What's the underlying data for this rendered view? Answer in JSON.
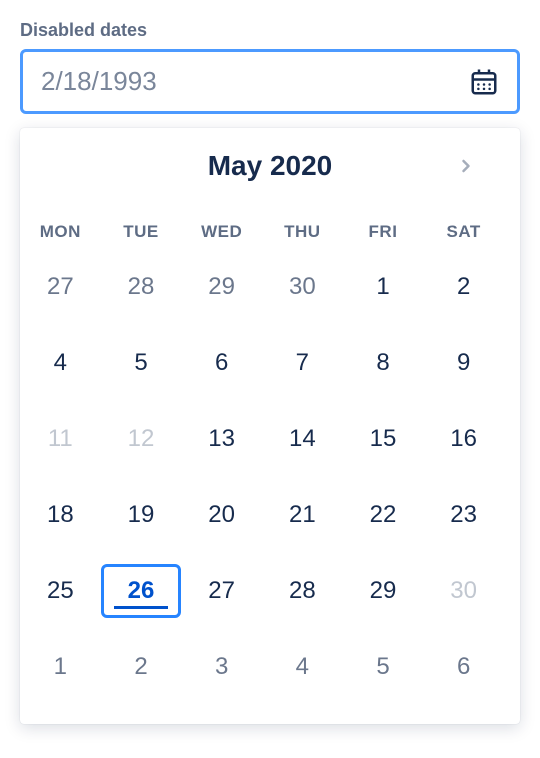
{
  "field": {
    "label": "Disabled dates",
    "placeholder": "2/18/1993"
  },
  "calendar": {
    "monthYear": "May 2020",
    "weekdays": [
      "MON",
      "TUE",
      "WED",
      "THU",
      "FRI",
      "SAT"
    ],
    "days": [
      {
        "num": "27",
        "type": "other-month"
      },
      {
        "num": "28",
        "type": "other-month"
      },
      {
        "num": "29",
        "type": "other-month"
      },
      {
        "num": "30",
        "type": "other-month"
      },
      {
        "num": "1",
        "type": "normal"
      },
      {
        "num": "2",
        "type": "normal"
      },
      {
        "num": "4",
        "type": "normal"
      },
      {
        "num": "5",
        "type": "normal"
      },
      {
        "num": "6",
        "type": "normal"
      },
      {
        "num": "7",
        "type": "normal"
      },
      {
        "num": "8",
        "type": "normal"
      },
      {
        "num": "9",
        "type": "normal"
      },
      {
        "num": "11",
        "type": "disabled"
      },
      {
        "num": "12",
        "type": "disabled"
      },
      {
        "num": "13",
        "type": "normal"
      },
      {
        "num": "14",
        "type": "normal"
      },
      {
        "num": "15",
        "type": "normal"
      },
      {
        "num": "16",
        "type": "normal"
      },
      {
        "num": "18",
        "type": "normal"
      },
      {
        "num": "19",
        "type": "normal"
      },
      {
        "num": "20",
        "type": "normal"
      },
      {
        "num": "21",
        "type": "normal"
      },
      {
        "num": "22",
        "type": "normal"
      },
      {
        "num": "23",
        "type": "normal"
      },
      {
        "num": "25",
        "type": "normal"
      },
      {
        "num": "26",
        "type": "selected"
      },
      {
        "num": "27",
        "type": "normal"
      },
      {
        "num": "28",
        "type": "normal"
      },
      {
        "num": "29",
        "type": "normal"
      },
      {
        "num": "30",
        "type": "disabled"
      },
      {
        "num": "1",
        "type": "other-month"
      },
      {
        "num": "2",
        "type": "other-month"
      },
      {
        "num": "3",
        "type": "other-month"
      },
      {
        "num": "4",
        "type": "other-month"
      },
      {
        "num": "5",
        "type": "other-month"
      },
      {
        "num": "6",
        "type": "other-month"
      }
    ]
  }
}
